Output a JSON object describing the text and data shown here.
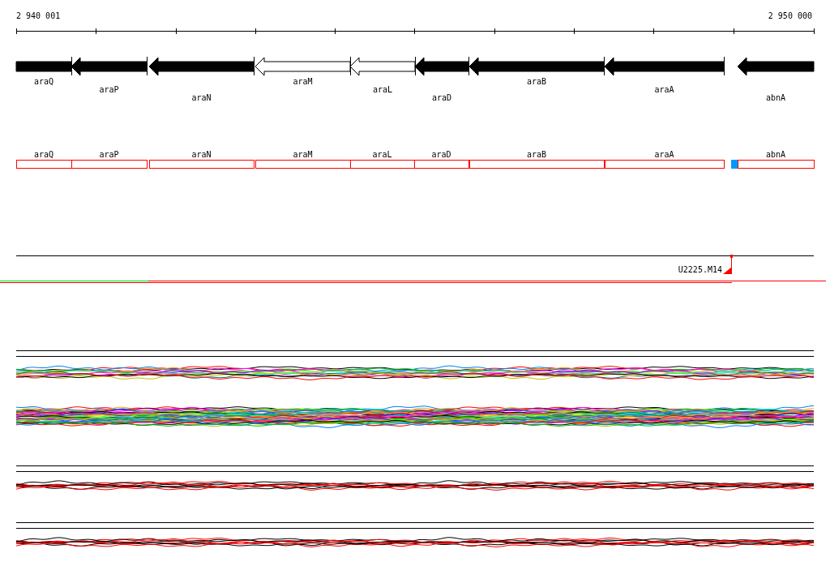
{
  "ruler": {
    "start": "2 940 001",
    "end": "2 950 000"
  },
  "genes": [
    {
      "name": "araQ",
      "filled": true
    },
    {
      "name": "araP",
      "filled": true
    },
    {
      "name": "araN",
      "filled": true
    },
    {
      "name": "araM",
      "filled": false
    },
    {
      "name": "araL",
      "filled": false
    },
    {
      "name": "araD",
      "filled": true
    },
    {
      "name": "araB",
      "filled": true
    },
    {
      "name": "araA",
      "filled": true
    },
    {
      "name": "abnA",
      "filled": true
    }
  ],
  "annotations": [
    {
      "name": "araQ",
      "flagged": false
    },
    {
      "name": "araP",
      "flagged": false
    },
    {
      "name": "araN",
      "flagged": false
    },
    {
      "name": "araM",
      "flagged": false
    },
    {
      "name": "araL",
      "flagged": false
    },
    {
      "name": "araD",
      "flagged": false
    },
    {
      "name": "araB",
      "flagged": false
    },
    {
      "name": "araA",
      "flagged": false
    },
    {
      "name": "abnA",
      "flagged": true
    }
  ],
  "marker": {
    "label": "U2225.M14"
  },
  "trace_panels": [
    {
      "kind": "multicolor"
    },
    {
      "kind": "redblack"
    },
    {
      "kind": "redblack"
    }
  ]
}
